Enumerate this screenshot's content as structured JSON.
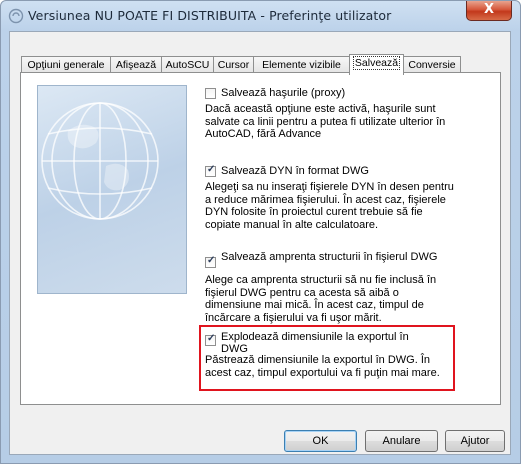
{
  "window": {
    "title": "Versiunea NU POATE FI DISTRIBUITA - Preferinţe utilizator",
    "close_label": "X"
  },
  "tabs": [
    {
      "label": "Opţiuni generale"
    },
    {
      "label": "Afişează"
    },
    {
      "label": "AutoSCU"
    },
    {
      "label": "Cursor"
    },
    {
      "label": "Elemente vizibile"
    },
    {
      "label": "Salvează",
      "active": true
    },
    {
      "label": "Conversie"
    }
  ],
  "options": [
    {
      "label": "Salvează haşurile (proxy)",
      "checked": false,
      "description": "Dacă această opţiune este activă, haşurile sunt salvate ca linii pentru a putea fi utilizate ulterior în AutoCAD, fără Advance"
    },
    {
      "label": "Salvează DYN în format DWG",
      "checked": true,
      "description": "Alegeţi sa nu inseraţi fişierele DYN în desen pentru a reduce mărimea fişierului. În acest caz, fişierele DYN folosite în proiectul curent trebuie să fie copiate manual în alte calculatoare."
    },
    {
      "label": "Salvează amprenta structurii în fişierul DWG",
      "checked": true,
      "description": "Alege ca amprenta structurii să nu fie inclusă în fişierul DWG pentru ca acesta să aibă o dimensiune mai mică. În acest caz, timpul de încărcare a fişierului va fi uşor mărit."
    },
    {
      "label": "Explodează dimensiunile la exportul în DWG",
      "checked": true,
      "description": "Păstrează dimensiunile la exportul în DWG. În acest caz, timpul exportului va fi puţin mai mare."
    }
  ],
  "buttons": {
    "ok": "OK",
    "cancel": "Anulare",
    "help": "Ajutor"
  },
  "colors": {
    "highlight": "#e0141e",
    "close": "#c94a2c"
  }
}
